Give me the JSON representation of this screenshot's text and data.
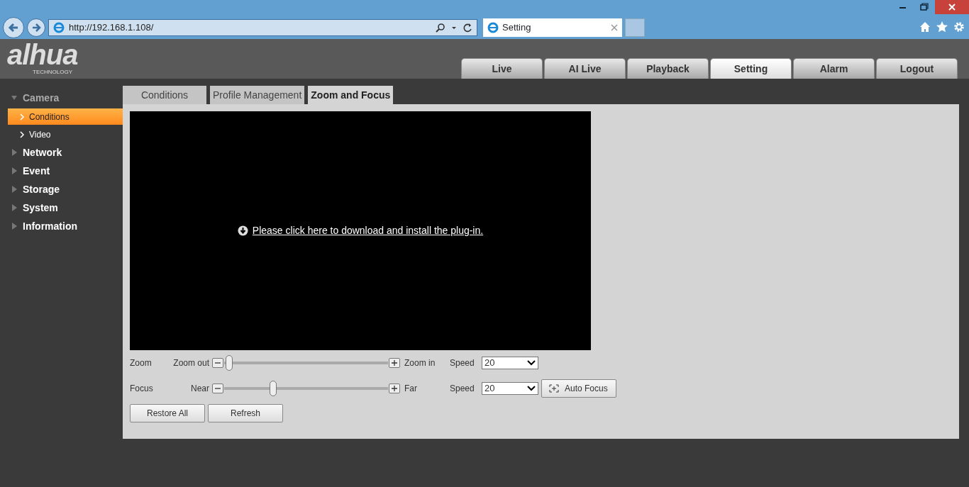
{
  "browser": {
    "address": "http://192.168.1.108/",
    "tab_title": "Setting"
  },
  "logo": {
    "name": "alhua",
    "tagline": "TECHNOLOGY"
  },
  "top_tabs": [
    {
      "label": "Live",
      "selected": false
    },
    {
      "label": "AI Live",
      "selected": false
    },
    {
      "label": "Playback",
      "selected": false
    },
    {
      "label": "Setting",
      "selected": true
    },
    {
      "label": "Alarm",
      "selected": false
    },
    {
      "label": "Logout",
      "selected": false
    }
  ],
  "sidebar": {
    "items": [
      {
        "label": "Camera",
        "expanded": true,
        "children": [
          {
            "label": "Conditions",
            "selected": true
          },
          {
            "label": "Video",
            "selected": false
          }
        ]
      },
      {
        "label": "Network",
        "expanded": false
      },
      {
        "label": "Event",
        "expanded": false
      },
      {
        "label": "Storage",
        "expanded": false
      },
      {
        "label": "System",
        "expanded": false
      },
      {
        "label": "Information",
        "expanded": false
      }
    ]
  },
  "tabs": [
    {
      "label": "Conditions",
      "selected": false
    },
    {
      "label": "Profile Management",
      "selected": false
    },
    {
      "label": "Zoom and Focus",
      "selected": true
    }
  ],
  "video": {
    "plugin_link": "Please click here to download and install the plug-in."
  },
  "controls": [
    {
      "label": "Zoom",
      "minus_label": "Zoom out",
      "plus_label": "Zoom in",
      "level": 0.03,
      "speed_label": "Speed",
      "speed": "20"
    },
    {
      "label": "Focus",
      "minus_label": "Near",
      "plus_label": "Far",
      "level": 0.3,
      "speed_label": "Speed",
      "speed": "20",
      "button": "Auto Focus"
    }
  ],
  "buttons": [
    "Restore All",
    "Refresh"
  ]
}
